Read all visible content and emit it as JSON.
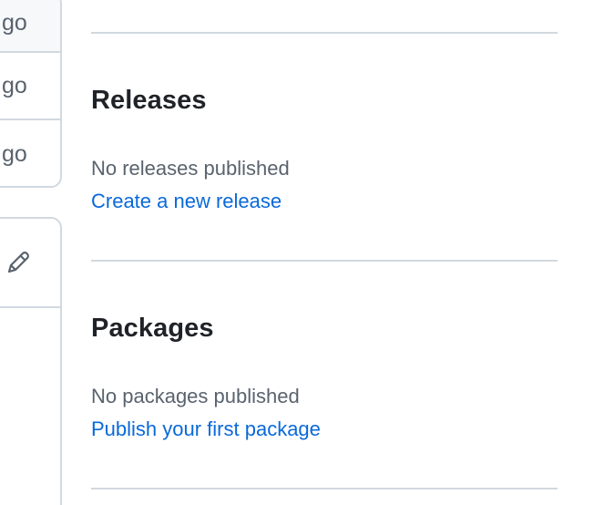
{
  "file_list": {
    "rows": [
      {
        "age": "go"
      },
      {
        "age": "go"
      },
      {
        "age": "go"
      }
    ]
  },
  "edit_panel": {
    "icon": "pencil-icon"
  },
  "releases": {
    "title": "Releases",
    "empty_text": "No releases published",
    "link_text": "Create a new release"
  },
  "packages": {
    "title": "Packages",
    "empty_text": "No packages published",
    "link_text": "Publish your first package"
  },
  "colors": {
    "link": "#0969da",
    "muted": "#59636e",
    "border": "#d1d9e0",
    "heading": "#1f2328"
  }
}
